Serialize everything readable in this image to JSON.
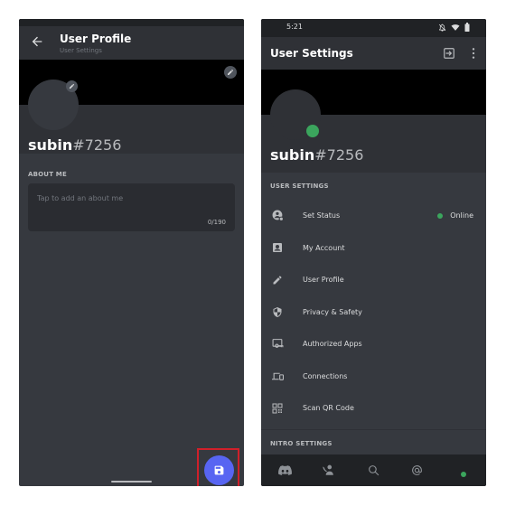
{
  "left_screen": {
    "header": {
      "title": "User Profile",
      "subtitle": "User Settings"
    },
    "profile": {
      "username": "subin",
      "discriminator": "#7256"
    },
    "about_me": {
      "label": "ABOUT ME",
      "placeholder": "Tap to add an about me",
      "char_count": "0/190"
    },
    "save_button": {
      "icon": "save-icon",
      "color": "#5865f2"
    },
    "highlight_color": "#d0202a"
  },
  "right_screen": {
    "status_bar": {
      "time": "5:21",
      "icons": [
        "notifications-off-icon",
        "wifi-icon",
        "battery-icon"
      ]
    },
    "header": {
      "title": "User Settings",
      "actions": [
        "logout-icon",
        "more-vert-icon"
      ]
    },
    "profile": {
      "username": "subin",
      "discriminator": "#7256",
      "status_color": "#3ba55d"
    },
    "sections": {
      "user_settings_label": "USER SETTINGS",
      "nitro_settings_label": "NITRO SETTINGS"
    },
    "menu_items": [
      {
        "label": "Set Status",
        "icon": "set-status-icon",
        "status": "Online"
      },
      {
        "label": "My Account",
        "icon": "account-icon"
      },
      {
        "label": "User Profile",
        "icon": "pencil-icon"
      },
      {
        "label": "Privacy & Safety",
        "icon": "shield-icon"
      },
      {
        "label": "Authorized Apps",
        "icon": "authorized-apps-icon"
      },
      {
        "label": "Connections",
        "icon": "devices-icon"
      },
      {
        "label": "Scan QR Code",
        "icon": "qr-code-icon"
      }
    ],
    "bottom_nav": [
      "discord-home-icon",
      "friends-icon",
      "search-icon",
      "mentions-icon",
      "profile-status-icon"
    ]
  }
}
